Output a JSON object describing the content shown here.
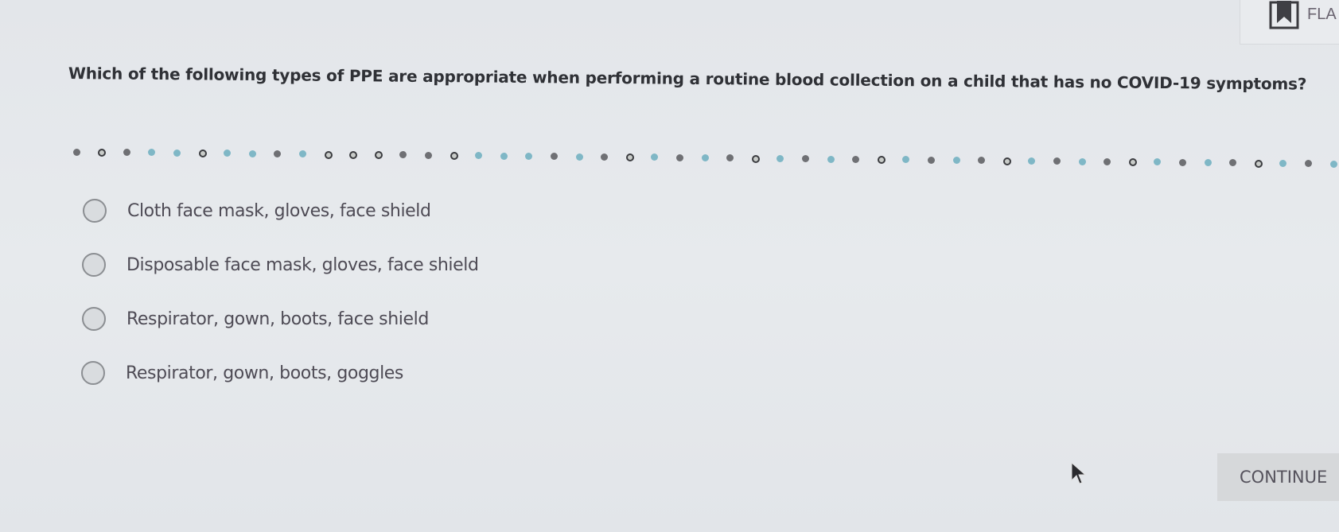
{
  "flag": {
    "label": "FLA",
    "icon": "bookmark-icon"
  },
  "question": {
    "text": "Which of the following types of PPE are appropriate when performing a routine blood collection on a child that has no COVID-19 symptoms?"
  },
  "progress_dots": {
    "colors": {
      "gray": "#6f7074",
      "teal": "#7fb7c6",
      "ring": "#3b3c40"
    },
    "sequence": [
      "gray",
      "ring",
      "gray",
      "teal",
      "teal",
      "ring",
      "teal",
      "teal",
      "gray",
      "teal",
      "ring",
      "ring",
      "ring",
      "gray",
      "gray",
      "ring",
      "teal",
      "teal",
      "teal",
      "gray",
      "teal",
      "gray",
      "ring",
      "teal",
      "gray",
      "teal",
      "gray",
      "ring",
      "teal",
      "gray",
      "teal",
      "gray",
      "ring",
      "teal",
      "gray",
      "teal",
      "gray",
      "ring",
      "teal",
      "gray",
      "teal",
      "gray",
      "ring",
      "teal",
      "gray",
      "teal",
      "gray",
      "ring",
      "teal",
      "gray",
      "teal",
      "teal"
    ]
  },
  "options": [
    {
      "label": "Cloth face mask, gloves, face shield",
      "selected": false
    },
    {
      "label": "Disposable face mask, gloves, face shield",
      "selected": false
    },
    {
      "label": "Respirator, gown, boots, face shield",
      "selected": false
    },
    {
      "label": "Respirator, gown, boots, goggles",
      "selected": false
    }
  ],
  "continue_button": {
    "label": "CONTINUE"
  }
}
